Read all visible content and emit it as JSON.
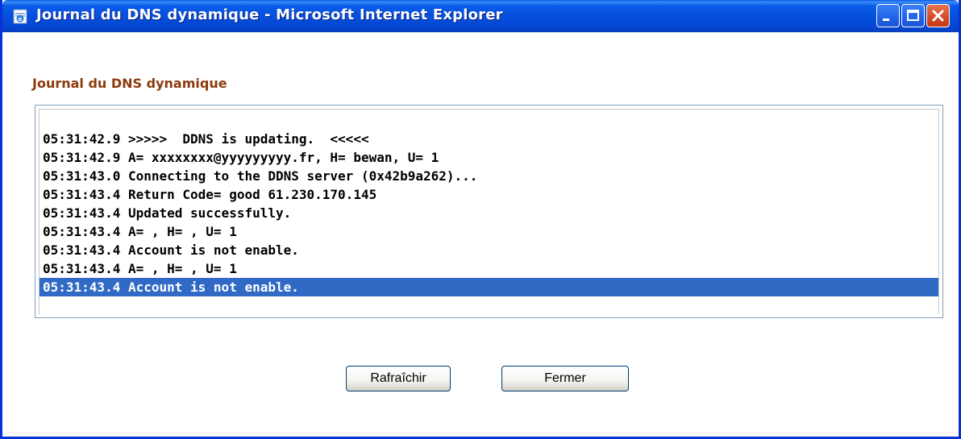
{
  "window": {
    "title": "Journal du DNS dynamique - Microsoft Internet Explorer",
    "app_icon": "ie-page-icon",
    "controls": [
      "minimize-icon",
      "maximize-icon",
      "close-icon"
    ]
  },
  "page": {
    "heading": "Journal du DNS dynamique"
  },
  "log": {
    "lines": [
      "05:31:42.9 >>>>>  DDNS is updating.  <<<<<",
      "05:31:42.9 A= xxxxxxxx@yyyyyyyyy.fr, H= bewan, U= 1",
      "05:31:43.0 Connecting to the DDNS server (0x42b9a262)...",
      "05:31:43.4 Return Code= good 61.230.170.145",
      "05:31:43.4 Updated successfully.",
      "05:31:43.4 A= , H= , U= 1",
      "05:31:43.4 Account is not enable.",
      "05:31:43.4 A= , H= , U= 1",
      "05:31:43.4 Account is not enable."
    ],
    "selected_index": 8
  },
  "buttons": {
    "refresh_label": "Rafraîchir",
    "close_label": "Fermer"
  },
  "colors": {
    "titlebar": "#0550dd",
    "heading": "#8b3a0e",
    "selection": "#316ac5"
  }
}
